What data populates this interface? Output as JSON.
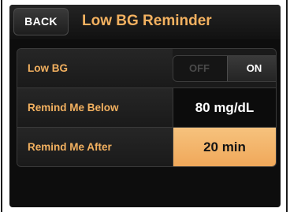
{
  "header": {
    "back_label": "BACK",
    "title": "Low BG Reminder"
  },
  "settings": {
    "low_bg": {
      "label": "Low BG",
      "off_label": "OFF",
      "on_label": "ON",
      "state": "ON"
    },
    "remind_below": {
      "label": "Remind Me Below",
      "value": "80 mg/dL"
    },
    "remind_after": {
      "label": "Remind Me After",
      "value": "20 min",
      "selected": true
    }
  },
  "colors": {
    "accent": "#f3b160",
    "selected_fill": "#f4b56c",
    "background": "#0d0d0d"
  }
}
